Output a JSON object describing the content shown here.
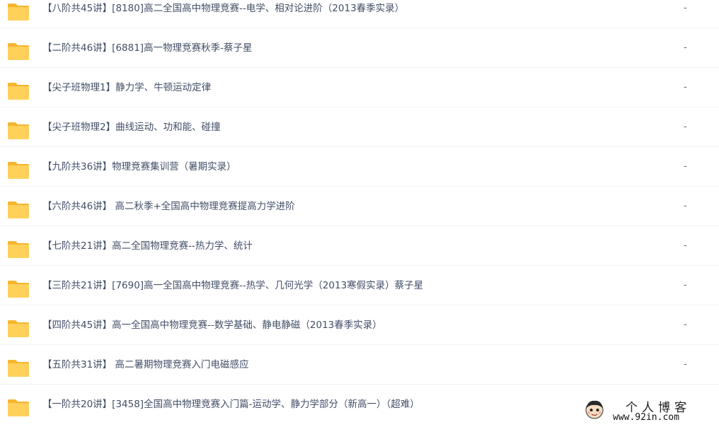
{
  "files": [
    {
      "name": "【八阶共45讲】[8180]高二全国高中物理竞赛--电学、相对论进阶（2013春季实录）",
      "size": "-"
    },
    {
      "name": "【二阶共46讲】[6881]高一物理竞赛秋季-蔡子星",
      "size": "-"
    },
    {
      "name": "【尖子班物理1】静力学、牛顿运动定律",
      "size": "-"
    },
    {
      "name": "【尖子班物理2】曲线运动、功和能、碰撞",
      "size": "-"
    },
    {
      "name": "【九阶共36讲】物理竞赛集训营（暑期实录）",
      "size": "-"
    },
    {
      "name": "【六阶共46讲】 高二秋季+全国高中物理竞赛提高力学进阶",
      "size": "-"
    },
    {
      "name": "【七阶共21讲】高二全国物理竞赛--热力学、统计",
      "size": "-"
    },
    {
      "name": "【三阶共21讲】[7690]高一全国高中物理竞赛--热学、几何光学（2013寒假实录）蔡子星",
      "size": "-"
    },
    {
      "name": "【四阶共45讲】高一全国高中物理竞赛--数学基础、静电静磁（2013春季实录）",
      "size": "-"
    },
    {
      "name": "【五阶共31讲】 高二暑期物理竞赛入门电磁感应",
      "size": "-"
    },
    {
      "name": "【一阶共20讲】[3458]全国高中物理竞赛入门篇-运动学、静力学部分（新高一）（超难）",
      "size": "-"
    }
  ],
  "watermark": {
    "title": "个人博客",
    "url": "www.92in.com"
  },
  "colors": {
    "folder": "#ffd15b",
    "folder_tab": "#f5b52f",
    "text": "#424e67",
    "divider": "#f1f2f4"
  },
  "icons": {
    "folder": "folder-icon",
    "watermark_face": "cartoon-face-icon"
  }
}
